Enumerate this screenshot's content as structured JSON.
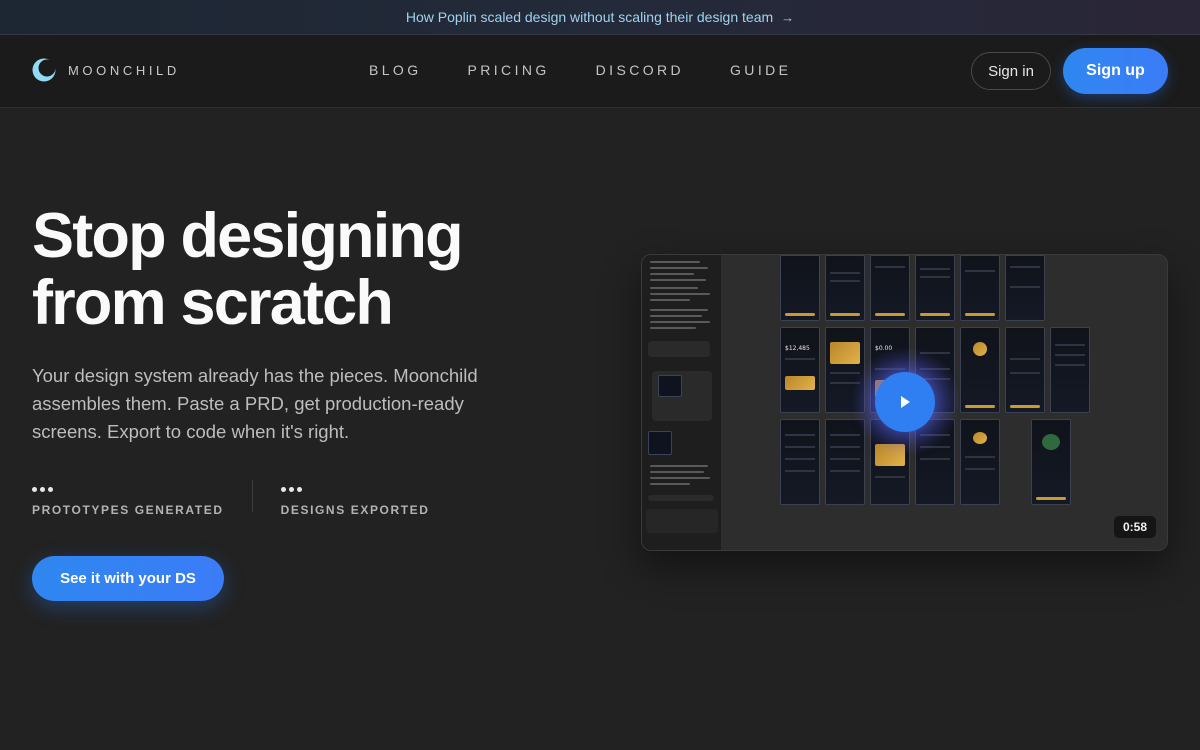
{
  "announcement": {
    "text": "How Poplin scaled design without scaling their design team",
    "arrow_icon": "arrow-right-icon"
  },
  "brand": {
    "name": "MOONCHILD",
    "logo_icon": "crescent-moon-icon",
    "accent_color": "#7fd4f0"
  },
  "nav": {
    "links": [
      "BLOG",
      "PRICING",
      "DISCORD",
      "GUIDE"
    ],
    "signin_label": "Sign in",
    "signup_label": "Sign up"
  },
  "hero": {
    "title_line1": "Stop designing",
    "title_line2": "from scratch",
    "subtitle": "Your design system already has the pieces. Moonchild assembles them. Paste a PRD, get production-ready screens. Export to code when it's right.",
    "stats": [
      {
        "value": "•••",
        "label": "PROTOTYPES GENERATED"
      },
      {
        "value": "•••",
        "label": "DESIGNS EXPORTED"
      }
    ],
    "cta_label": "See it with your DS",
    "cta_color": "#2f87f0"
  },
  "video": {
    "duration": "0:58",
    "play_icon": "play-icon"
  }
}
